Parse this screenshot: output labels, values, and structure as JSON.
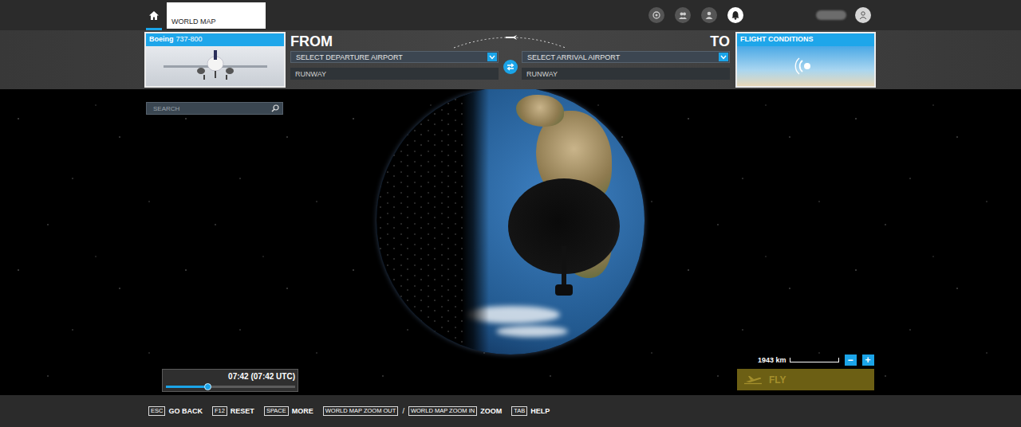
{
  "home": {
    "selected": true
  },
  "breadcrumb": [
    {
      "label": "WORLD MAP",
      "selected": true
    }
  ],
  "header_icons": [
    {
      "active": false
    },
    {
      "active": false
    },
    {
      "active": false
    },
    {
      "active": true
    }
  ],
  "aircraft": {
    "manufacturer": "Boeing",
    "model": "737-800"
  },
  "route": {
    "from_label": "FROM",
    "to_label": "TO",
    "departure": {
      "placeholder": "SELECT DEPARTURE AIRPORT",
      "runway": "RUNWAY"
    },
    "arrival": {
      "placeholder": "SELECT ARRIVAL AIRPORT",
      "runway": "RUNWAY"
    }
  },
  "conditions": {
    "title": "FLIGHT CONDITIONS"
  },
  "search": {
    "placeholder": "SEARCH"
  },
  "time": {
    "reading": "07:42 (07:42 UTC)",
    "level": 0.33
  },
  "scale": {
    "reading": "1943 km",
    "zoom_out": "−",
    "zoom_in": "+"
  },
  "fly": {
    "label": "FLY",
    "disabled": true
  },
  "hint_separator": "/",
  "hints": [
    {
      "keys": [
        "ESC"
      ],
      "label": "GO BACK"
    },
    {
      "keys": [
        "F12"
      ],
      "label": "RESET"
    },
    {
      "keys": [
        "SPACE"
      ],
      "label": "MORE"
    },
    {
      "keys": [
        "WORLD MAP ZOOM OUT",
        "WORLD MAP ZOOM IN"
      ],
      "label": "ZOOM"
    },
    {
      "keys": [
        "TAB"
      ],
      "label": "HELP"
    }
  ]
}
